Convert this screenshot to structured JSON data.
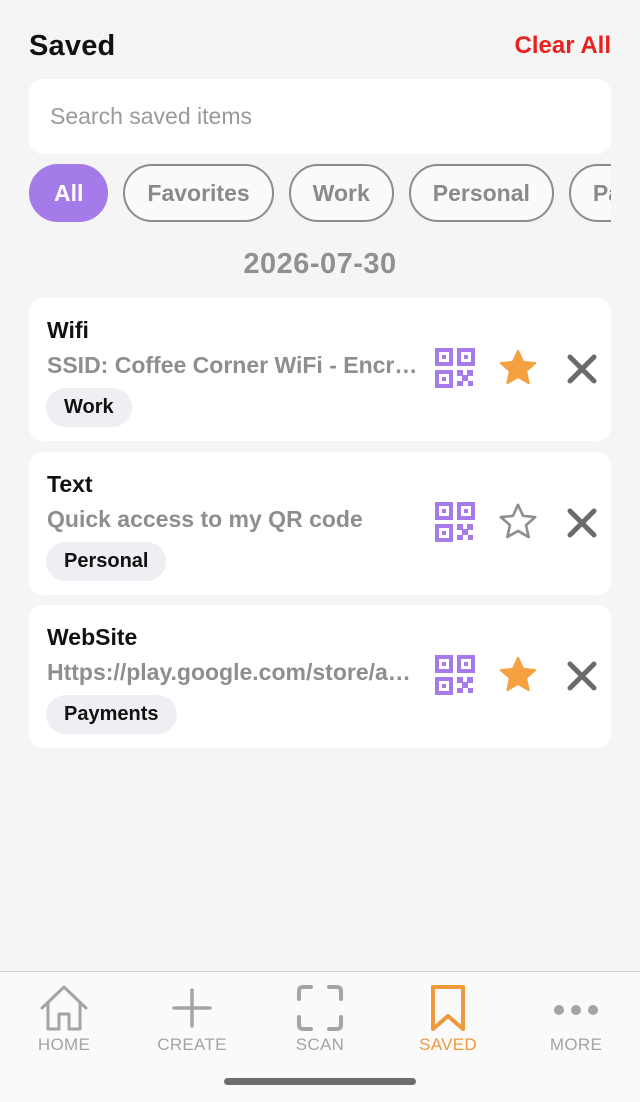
{
  "header": {
    "title": "Saved",
    "clear_all": "Clear All"
  },
  "search": {
    "placeholder": "Search saved items",
    "value": ""
  },
  "filters": [
    {
      "label": "All",
      "active": true
    },
    {
      "label": "Favorites",
      "active": false
    },
    {
      "label": "Work",
      "active": false
    },
    {
      "label": "Personal",
      "active": false
    },
    {
      "label": "Payments",
      "active": false
    }
  ],
  "date_group": "2026-07-30",
  "items": [
    {
      "type": "Wifi",
      "content": "SSID: Coffee Corner WiFi - Encryption: WPA",
      "tag": "Work",
      "favorite": true,
      "icons": [
        "qr-code-icon",
        "star-filled-icon",
        "close-icon"
      ]
    },
    {
      "type": "Text",
      "content": "Quick access to my QR code",
      "tag": "Personal",
      "favorite": false,
      "icons": [
        "qr-code-icon",
        "star-outline-icon",
        "close-icon"
      ]
    },
    {
      "type": "WebSite",
      "content": "Https://play.google.com/store/apps",
      "tag": "Payments",
      "favorite": true,
      "icons": [
        "qr-code-icon",
        "star-filled-icon",
        "close-icon"
      ]
    }
  ],
  "nav": [
    {
      "label": "HOME",
      "icon": "home-icon",
      "active": false
    },
    {
      "label": "CREATE",
      "icon": "plus-icon",
      "active": false
    },
    {
      "label": "SCAN",
      "icon": "scan-frame-icon",
      "active": false
    },
    {
      "label": "SAVED",
      "icon": "bookmark-icon",
      "active": true
    },
    {
      "label": "MORE",
      "icon": "more-dots-icon",
      "active": false
    }
  ],
  "colors": {
    "accent_purple": "#a47be8",
    "favorite_orange": "#f5a142",
    "danger_red": "#e8231f",
    "nav_active": "#f0983c",
    "nav_inactive": "#a4a4a4"
  }
}
